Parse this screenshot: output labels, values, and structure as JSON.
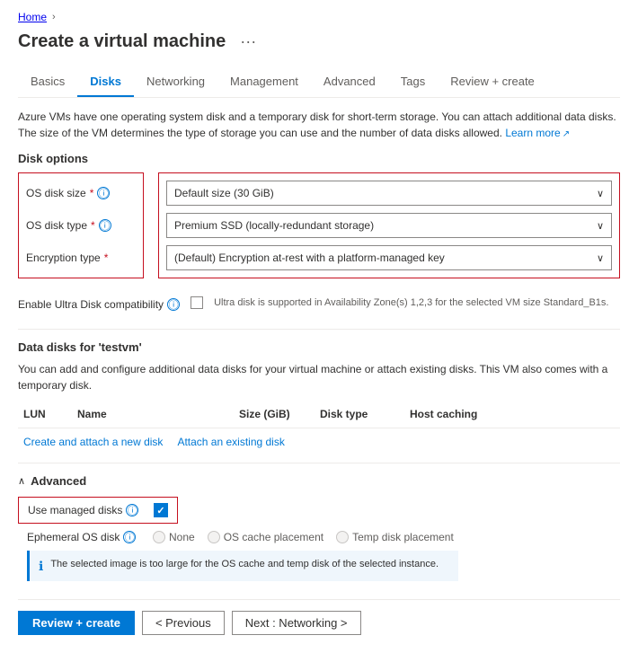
{
  "breadcrumb": {
    "home": "Home",
    "separator": "›"
  },
  "page": {
    "title": "Create a virtual machine",
    "more_options": "···"
  },
  "tabs": [
    {
      "id": "basics",
      "label": "Basics"
    },
    {
      "id": "disks",
      "label": "Disks",
      "active": true
    },
    {
      "id": "networking",
      "label": "Networking"
    },
    {
      "id": "management",
      "label": "Management"
    },
    {
      "id": "advanced",
      "label": "Advanced"
    },
    {
      "id": "tags",
      "label": "Tags"
    },
    {
      "id": "review",
      "label": "Review + create"
    }
  ],
  "description": {
    "text": "Azure VMs have one operating system disk and a temporary disk for short-term storage. You can attach additional data disks. The size of the VM determines the type of storage you can use and the number of data disks allowed.",
    "learn_more": "Learn more"
  },
  "disk_options": {
    "section_title": "Disk options",
    "labels": [
      {
        "id": "os-disk-size",
        "text": "OS disk size",
        "required": true
      },
      {
        "id": "os-disk-type",
        "text": "OS disk type",
        "required": true
      },
      {
        "id": "encryption-type",
        "text": "Encryption type",
        "required": true
      }
    ],
    "selects": [
      {
        "id": "os-disk-size-select",
        "value": "Default size (30 GiB)"
      },
      {
        "id": "os-disk-type-select",
        "value": "Premium SSD (locally-redundant storage)"
      },
      {
        "id": "encryption-type-select",
        "value": "(Default) Encryption at-rest with a platform-managed key"
      }
    ]
  },
  "ultra_disk": {
    "label": "Enable Ultra Disk compatibility",
    "note": "Ultra disk is supported in Availability Zone(s) 1,2,3 for the selected VM size Standard_B1s."
  },
  "data_disks": {
    "section_title": "Data disks for 'testvm'",
    "description": "You can add and configure additional data disks for your virtual machine or attach existing disks. This VM also comes with a temporary disk.",
    "columns": [
      "LUN",
      "Name",
      "Size (GiB)",
      "Disk type",
      "Host caching"
    ],
    "actions": [
      {
        "id": "create-attach",
        "label": "Create and attach a new disk"
      },
      {
        "id": "attach-existing",
        "label": "Attach an existing disk"
      }
    ]
  },
  "advanced_section": {
    "title": "Advanced",
    "managed_disks": {
      "label": "Use managed disks",
      "checked": true
    },
    "ephemeral": {
      "label": "Ephemeral OS disk",
      "options": [
        "None",
        "OS cache placement",
        "Temp disk placement"
      ]
    },
    "info_message": "The selected image is too large for the OS cache and temp disk of the selected instance."
  },
  "footer": {
    "review_create": "Review + create",
    "previous": "< Previous",
    "next": "Next : Networking >"
  }
}
